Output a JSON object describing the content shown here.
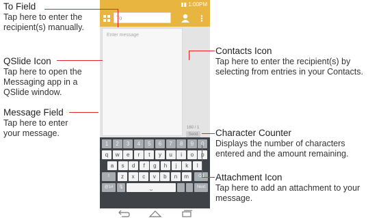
{
  "callouts": {
    "to_field": {
      "title": "To Field",
      "desc": "Tap here to enter the recipient(s) manually."
    },
    "qslide_icon": {
      "title": "QSlide Icon",
      "desc": "Tap here to open the Messaging app in a QSlide window."
    },
    "message_field": {
      "title": "Message Field",
      "desc": "Tap here to enter your message."
    },
    "contacts_icon": {
      "title": "Contacts Icon",
      "desc": "Tap here to enter the recipient(s) by selecting from entries in your Contacts."
    },
    "character_counter": {
      "title": "Character Counter",
      "desc": "Displays the number of characters entered and the amount remaining."
    },
    "attachment_icon": {
      "title": "Attachment Icon",
      "desc": "Tap here to add an attachment to your message."
    }
  },
  "phone": {
    "status_time": "1:00PM",
    "to_placeholder": "To",
    "message_placeholder": "Enter message",
    "counter": "160 / 1",
    "send_label": "Send",
    "icons": {
      "qslide": "qslide-icon",
      "contacts": "contacts-icon",
      "menu": "menu-icon",
      "attach": "paperclip-icon",
      "mic": "mic-icon",
      "shift": "shift-icon",
      "backspace": "backspace-icon",
      "back": "back-icon",
      "home": "home-icon",
      "recents": "recents-icon"
    },
    "keyboard": {
      "row_numbers": [
        "1",
        "2",
        "3",
        "4",
        "5",
        "6",
        "7",
        "8",
        "9",
        "0"
      ],
      "row1": [
        "q",
        "w",
        "e",
        "r",
        "t",
        "y",
        "u",
        "i",
        "o",
        "p"
      ],
      "row2": [
        "a",
        "s",
        "d",
        "f",
        "g",
        "h",
        "j",
        "k",
        "l"
      ],
      "row3": [
        "z",
        "x",
        "c",
        "v",
        "b",
        "n",
        "m"
      ],
      "sym_label": "@1#",
      "next_label": "Next"
    }
  },
  "colors": {
    "accent": "#e8b640",
    "leader": "#e2252a",
    "keyboard_bg": "#3f4246"
  }
}
